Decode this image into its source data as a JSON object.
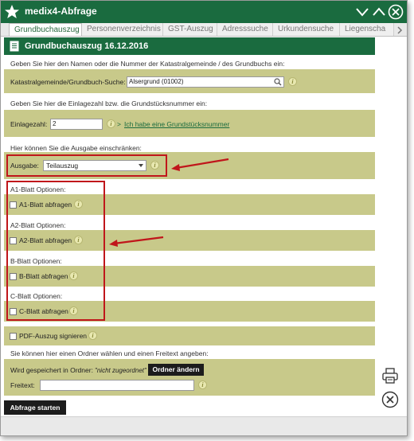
{
  "window": {
    "title": "medix4-Abfrage"
  },
  "tabs": [
    {
      "label": "Grundbuchauszug",
      "active": true
    },
    {
      "label": "Personenverzeichnis"
    },
    {
      "label": "GST-Auszug"
    },
    {
      "label": "Adresssuche"
    },
    {
      "label": "Urkundensuche"
    },
    {
      "label": "Liegenscha"
    }
  ],
  "header": {
    "title": "Grundbuchauszug 16.12.2016"
  },
  "section_kg": {
    "instruction": "Geben Sie hier den Namen oder die Nummer der Katastralgemeinde / des Grundbuchs ein:",
    "label": "Katastralgemeinde/Grundbuch-Suche:",
    "value": "Alsergrund (01002)"
  },
  "section_ez": {
    "instruction": "Geben Sie hier die Einlagezahl bzw. die Grundstücksnummer ein:",
    "label": "Einlagezahl:",
    "value": "2",
    "link_prefix": ">",
    "link_text": "Ich habe eine Grundstücksnummer"
  },
  "section_ausgabe": {
    "instruction": "Hier können Sie die Ausgabe einschränken:",
    "label": "Ausgabe:",
    "selected": "Teilauszug"
  },
  "options": [
    {
      "heading": "A1-Blatt Optionen:",
      "checkbox": "A1-Blatt abfragen"
    },
    {
      "heading": "A2-Blatt Optionen:",
      "checkbox": "A2-Blatt abfragen"
    },
    {
      "heading": "B-Blatt Optionen:",
      "checkbox": "B-Blatt abfragen"
    },
    {
      "heading": "C-Blatt Optionen:",
      "checkbox": "C-Blatt abfragen"
    }
  ],
  "pdf_sign": {
    "label": "PDF-Auszug signieren"
  },
  "section_folder": {
    "instruction": "Sie können hier einen Ordner wählen und einen Freitext angeben:",
    "saved_label": "Wird gespeichert in Ordner:",
    "saved_value": "\"nicht zugeordnet\"",
    "change_button": "Ordner ändern",
    "freetext_label": "Freitext:",
    "freetext_value": ""
  },
  "submit": {
    "label": "Abfrage starten"
  },
  "colors": {
    "accent": "#1a6b3f",
    "band": "#c8c98a",
    "annotation": "#c0161b"
  },
  "icons": [
    "star-logo-icon",
    "minimize-icon",
    "maximize-icon",
    "close-icon",
    "info-icon",
    "search-icon",
    "document-icon",
    "printer-icon",
    "close-circle-icon",
    "red-arrow-icon"
  ]
}
